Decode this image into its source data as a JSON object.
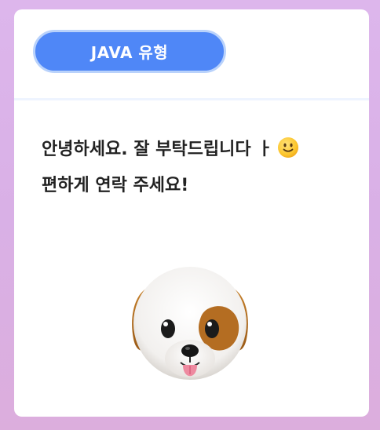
{
  "card": {
    "type_label": "JAVA 유형",
    "message_line1": "안녕하세요. 잘 부탁드립니다 ㅏ",
    "message_line2": "편하게 연락 주세요!",
    "emoji_icon": "slightly-smiling-face-icon",
    "avatar_icon": "dog-face-icon"
  },
  "colors": {
    "background": "#ddb6ec",
    "pill": "#4f87f7",
    "pill_border": "#b9d2fb",
    "text": "#222222"
  }
}
